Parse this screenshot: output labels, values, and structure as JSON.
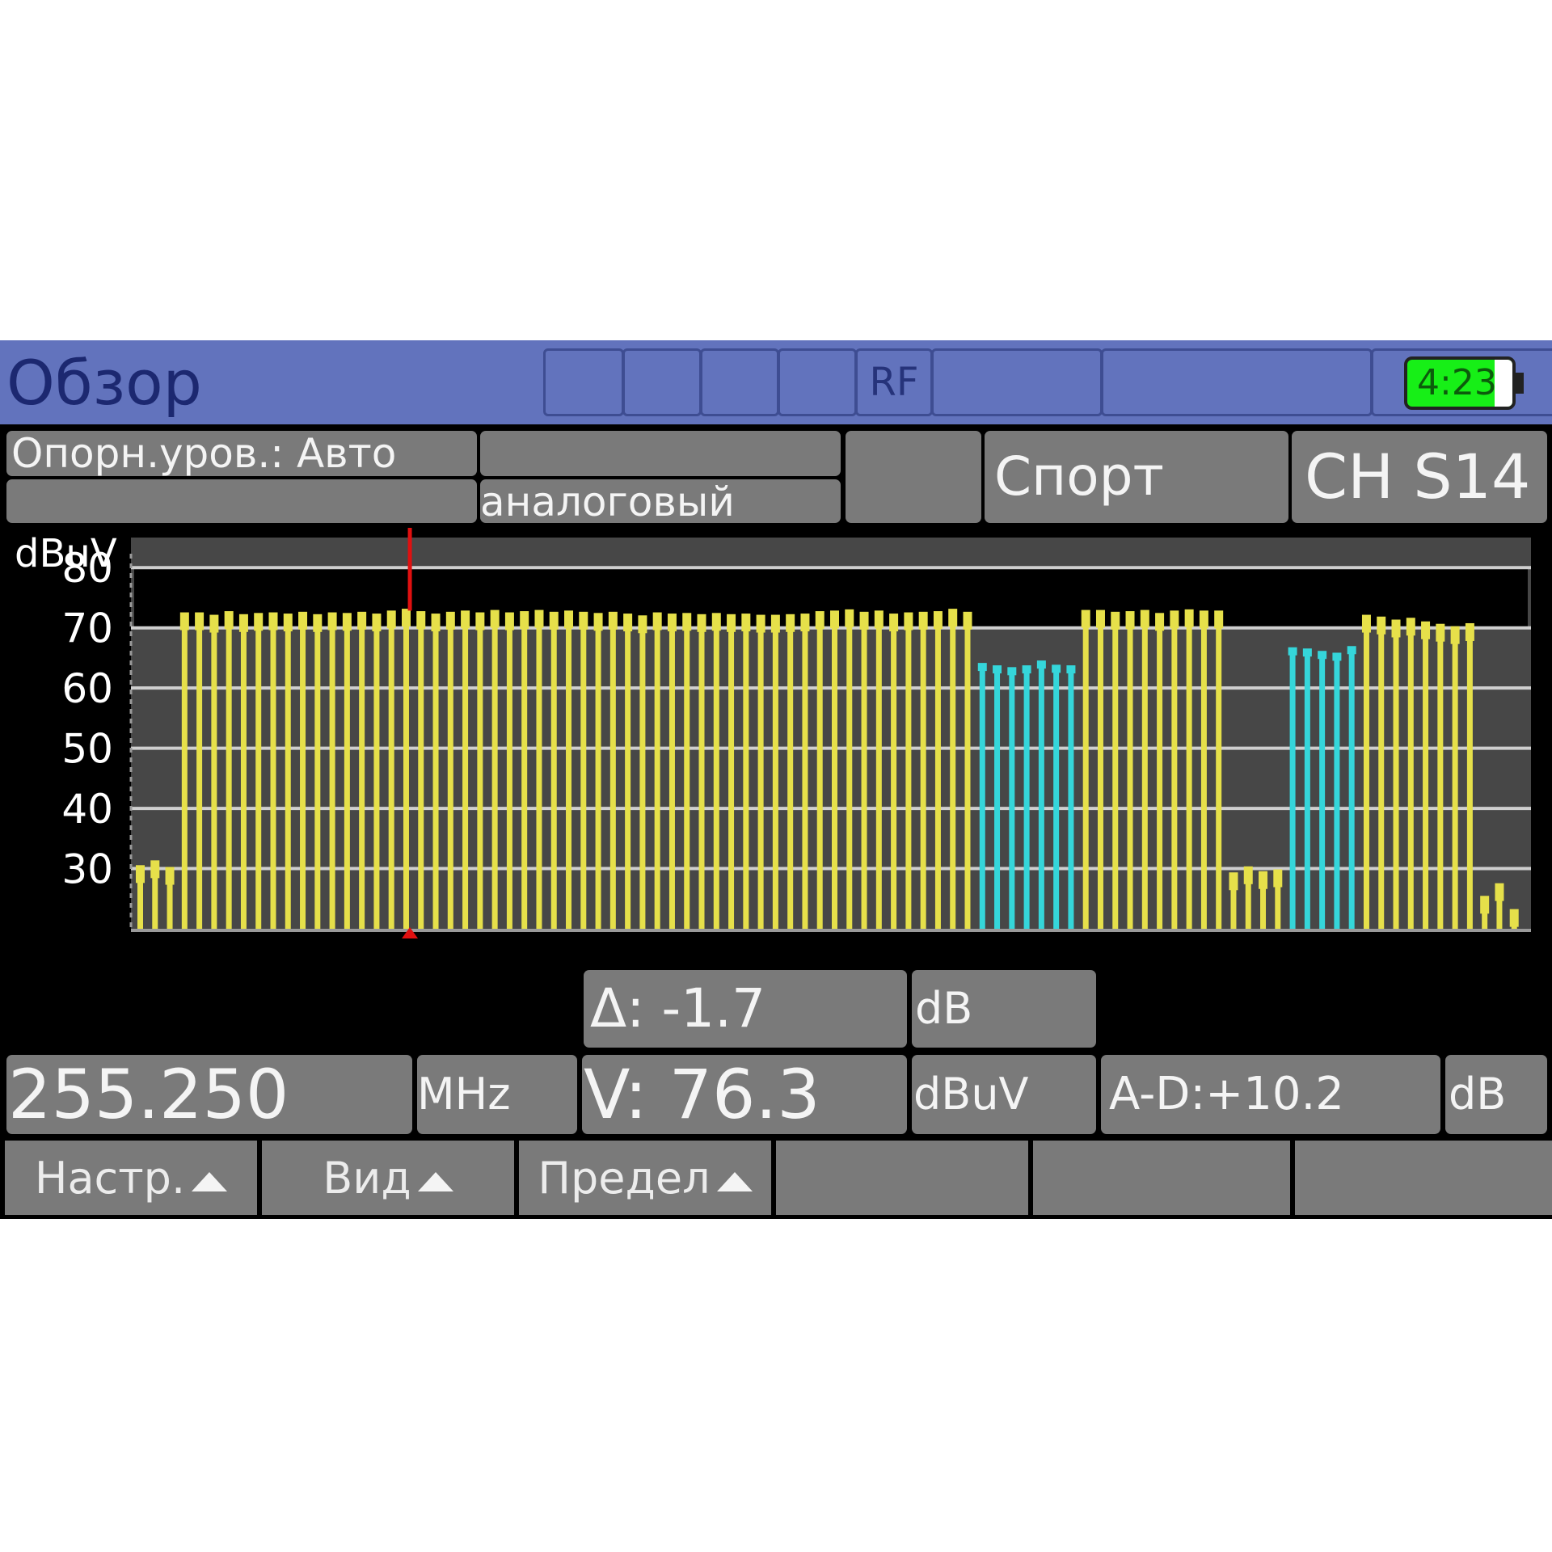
{
  "title_bar": {
    "title": "Обзор",
    "rf_label": "RF",
    "battery_time": "4:23"
  },
  "info_row": {
    "ref_level": "Опорн.уров.: Авто",
    "signal_type": "аналоговый",
    "channel_plan": "Спорт",
    "channel": "CH S14"
  },
  "readouts": {
    "delta": "Δ: -1.7",
    "delta_unit": "dB",
    "frequency": "255.250",
    "frequency_unit": "MHz",
    "level": "V: 76.3",
    "level_unit": "dBuV",
    "ad": "A-D:+10.2",
    "ad_unit": "dB"
  },
  "softkeys": [
    "Настр.",
    "Вид",
    "Предел",
    "",
    "",
    ""
  ],
  "colors": {
    "analog_bar": "#e6e04a",
    "digital_bar": "#35d6da",
    "marker": "#e01010",
    "title_bg": "#6273bd",
    "battery": "#17ef17"
  },
  "chart_data": {
    "type": "bar",
    "ylabel": "dBuV",
    "yticks": [
      80,
      70,
      60,
      50,
      40,
      30
    ],
    "ylim": [
      20,
      85
    ],
    "limit_lines": [
      80,
      70
    ],
    "grid": true,
    "marker_index": 18,
    "series": [
      {
        "values": [
          30.3,
          31.1,
          30.0,
          72.3,
          72.3,
          71.9,
          72.5,
          72.0,
          72.2,
          72.3,
          72.1,
          72.4,
          72.0,
          72.3,
          72.2,
          72.4,
          72.1,
          72.6,
          72.9,
          72.5,
          72.1,
          72.4,
          72.6,
          72.3,
          72.7,
          72.3,
          72.5,
          72.7,
          72.4,
          72.6,
          72.4,
          72.2,
          72.4,
          72.1,
          71.8,
          72.3,
          72.1,
          72.2,
          72.0,
          72.2,
          72.0,
          72.1,
          71.9,
          71.9,
          72.0,
          72.1,
          72.5,
          72.6,
          72.8,
          72.4,
          72.6,
          72.1,
          72.3,
          72.4,
          72.5,
          72.9,
          72.4,
          63.9,
          63.5,
          63.2,
          63.5,
          64.3,
          63.6,
          63.5,
          72.7,
          72.7,
          72.4,
          72.5,
          72.7,
          72.2,
          72.6,
          72.8,
          72.6,
          72.6,
          29.1,
          30.1,
          29.3,
          29.6,
          66.5,
          66.3,
          65.9,
          65.6,
          66.7,
          71.9,
          71.6,
          71.1,
          71.4,
          70.8,
          70.4,
          70.0,
          70.5,
          25.2,
          27.3,
          23.0
        ],
        "colors": [
          "a",
          "a",
          "a",
          "a",
          "a",
          "a",
          "a",
          "a",
          "a",
          "a",
          "a",
          "a",
          "a",
          "a",
          "a",
          "a",
          "a",
          "a",
          "a",
          "a",
          "a",
          "a",
          "a",
          "a",
          "a",
          "a",
          "a",
          "a",
          "a",
          "a",
          "a",
          "a",
          "a",
          "a",
          "a",
          "a",
          "a",
          "a",
          "a",
          "a",
          "a",
          "a",
          "a",
          "a",
          "a",
          "a",
          "a",
          "a",
          "a",
          "a",
          "a",
          "a",
          "a",
          "a",
          "a",
          "a",
          "a",
          "d",
          "d",
          "d",
          "d",
          "d",
          "d",
          "d",
          "a",
          "a",
          "a",
          "a",
          "a",
          "a",
          "a",
          "a",
          "a",
          "a",
          "a",
          "a",
          "a",
          "a",
          "d",
          "d",
          "d",
          "d",
          "d",
          "a",
          "a",
          "a",
          "a",
          "a",
          "a",
          "a",
          "a",
          "a",
          "a",
          "a"
        ]
      }
    ]
  }
}
